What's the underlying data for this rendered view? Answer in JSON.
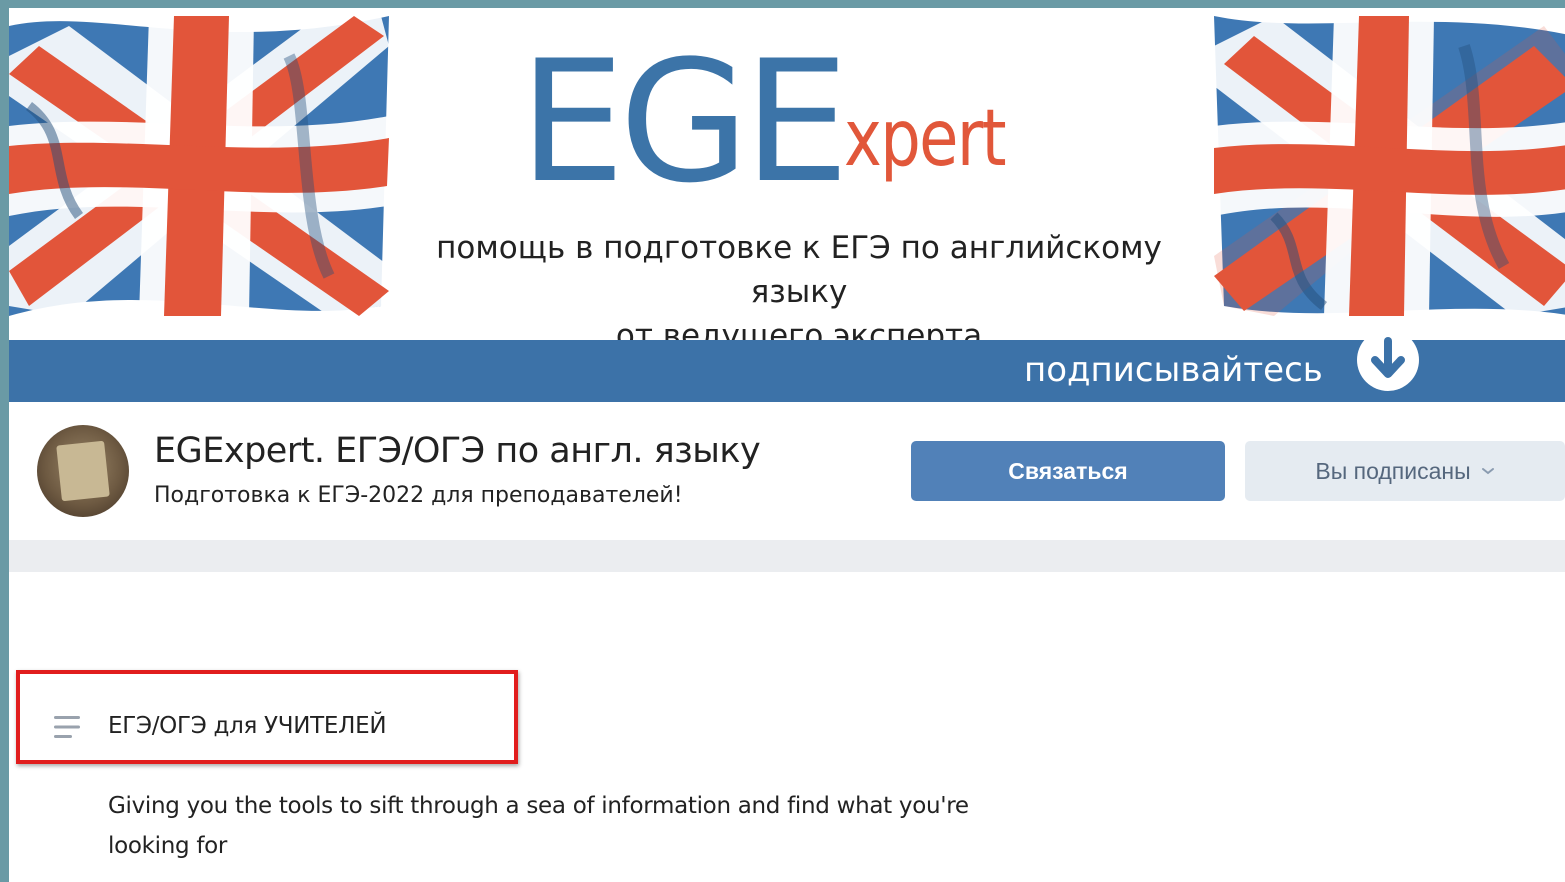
{
  "banner": {
    "logo_main": "EGE",
    "logo_suffix": "xpert",
    "tagline_line1": "помощь в подготовке к ЕГЭ по английскому языку",
    "tagline_line2": "от ведущего эксперта",
    "subscribe_label": "подписывайтесь"
  },
  "profile": {
    "name": "EGExpert. ЕГЭ/ОГЭ по англ. языку",
    "status": "Подготовка к ЕГЭ-2022 для преподавателей!",
    "contact_button": "Связаться",
    "subscribed_button": "Вы подписаны"
  },
  "section": {
    "title": "ЕГЭ/ОГЭ для УЧИТЕЛЕЙ",
    "description": "Giving you the tools to sift through a sea of information and find what you're looking for"
  },
  "colors": {
    "brand_blue": "#3c72a8",
    "accent_red": "#e1573a",
    "button_blue": "#5181b8",
    "highlight_red": "#e11d1d"
  },
  "icons": [
    "union-jack-flag-icon",
    "download-arrow-icon",
    "chevron-down-icon",
    "menu-lines-icon"
  ]
}
